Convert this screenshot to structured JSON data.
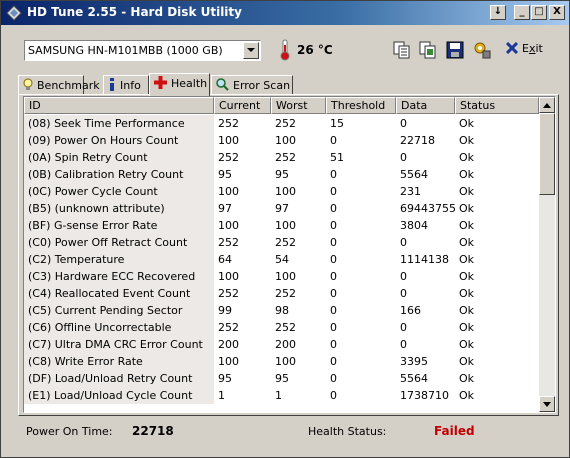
{
  "window": {
    "title": "HD Tune 2.55 - Hard Disk Utility",
    "buttons": [
      "↓",
      "_",
      "□",
      "X"
    ]
  },
  "toolbar": {
    "drive": "SAMSUNG HN-M101MBB (1000 GB)",
    "temperature": "26 °C",
    "exit_label": "Exit",
    "exit_underline": "x",
    "icons": [
      "copy-text-icon",
      "copy-screenshot-icon",
      "save-icon",
      "options-icon"
    ]
  },
  "tabs": [
    {
      "label": "Benchmark",
      "icon": "lightbulb-icon"
    },
    {
      "label": "Info",
      "icon": "info-icon"
    },
    {
      "label": "Health",
      "icon": "health-cross-icon",
      "active": true
    },
    {
      "label": "Error Scan",
      "icon": "magnifier-icon"
    }
  ],
  "table": {
    "columns": [
      "ID",
      "Current",
      "Worst",
      "Threshold",
      "Data",
      "Status"
    ],
    "rows": [
      [
        "(08) Seek Time Performance",
        "252",
        "252",
        "15",
        "0",
        "Ok"
      ],
      [
        "(09) Power On Hours Count",
        "100",
        "100",
        "0",
        "22718",
        "Ok"
      ],
      [
        "(0A) Spin Retry Count",
        "252",
        "252",
        "51",
        "0",
        "Ok"
      ],
      [
        "(0B) Calibration Retry Count",
        "95",
        "95",
        "0",
        "5564",
        "Ok"
      ],
      [
        "(0C) Power Cycle Count",
        "100",
        "100",
        "0",
        "231",
        "Ok"
      ],
      [
        "(B5) (unknown attribute)",
        "97",
        "97",
        "0",
        "69443755",
        "Ok"
      ],
      [
        "(BF) G-sense Error Rate",
        "100",
        "100",
        "0",
        "3804",
        "Ok"
      ],
      [
        "(C0) Power Off Retract Count",
        "252",
        "252",
        "0",
        "0",
        "Ok"
      ],
      [
        "(C2) Temperature",
        "64",
        "54",
        "0",
        "1114138",
        "Ok"
      ],
      [
        "(C3) Hardware ECC Recovered",
        "100",
        "100",
        "0",
        "0",
        "Ok"
      ],
      [
        "(C4) Reallocated Event Count",
        "252",
        "252",
        "0",
        "0",
        "Ok"
      ],
      [
        "(C5) Current Pending Sector",
        "99",
        "98",
        "0",
        "166",
        "Ok"
      ],
      [
        "(C6) Offline Uncorrectable",
        "252",
        "252",
        "0",
        "0",
        "Ok"
      ],
      [
        "(C7) Ultra DMA CRC Error Count",
        "200",
        "200",
        "0",
        "0",
        "Ok"
      ],
      [
        "(C8) Write Error Rate",
        "100",
        "100",
        "0",
        "3395",
        "Ok"
      ],
      [
        "(DF) Load/Unload Retry Count",
        "95",
        "95",
        "0",
        "5564",
        "Ok"
      ],
      [
        "(E1) Load/Unload Cycle Count",
        "1",
        "1",
        "0",
        "1738710",
        "Ok"
      ]
    ]
  },
  "status": {
    "power_on_label": "Power On Time:",
    "power_on_value": "22718",
    "health_label": "Health Status:",
    "health_value": "Failed"
  },
  "colors": {
    "title_start": "#0a246a",
    "title_end": "#a6caf0",
    "failed": "#c00000",
    "face": "#d4d0c8"
  }
}
